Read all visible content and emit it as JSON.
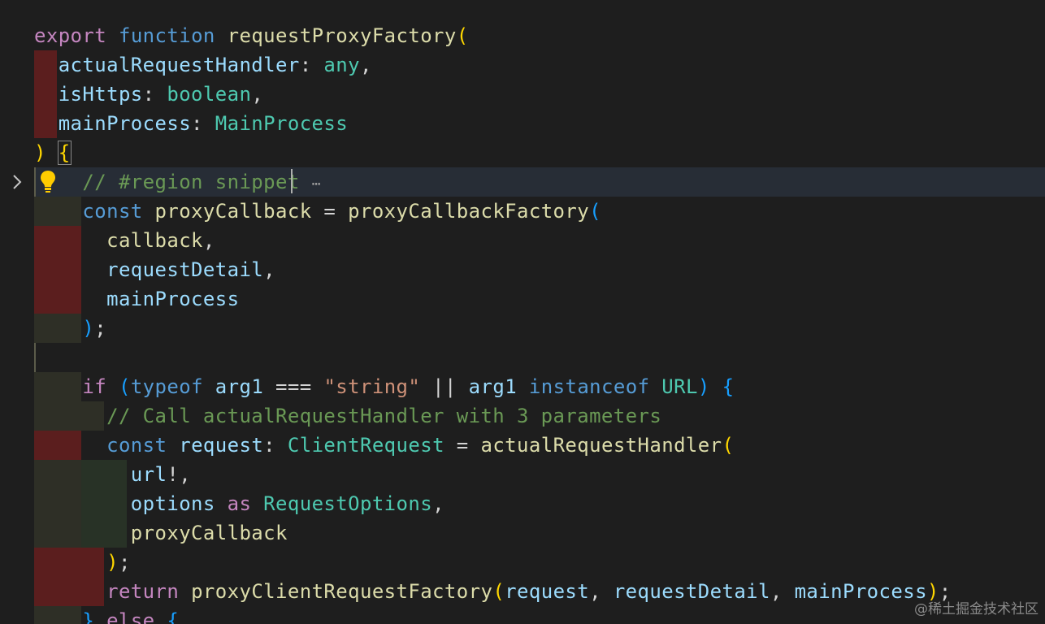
{
  "editor": {
    "language": "typescript",
    "colors": {
      "background": "#1e1e1e",
      "keyword": "#c586c0",
      "storage": "#569cd6",
      "function": "#dcdcaa",
      "variable": "#9cdcfe",
      "type": "#4ec9b0",
      "string": "#ce9178",
      "comment": "#6a9955"
    },
    "icons": {
      "fold": "chevron-right-icon",
      "lightbulb": "lightbulb-icon"
    },
    "lines": {
      "l1": {
        "export": "export",
        "function": "function",
        "name": "requestProxyFactory",
        "paren": "("
      },
      "l2": {
        "param": "actualRequestHandler",
        "colon": ": ",
        "type": "any",
        "comma": ","
      },
      "l3": {
        "param": "isHttps",
        "colon": ": ",
        "type": "boolean",
        "comma": ","
      },
      "l4": {
        "param": "mainProcess",
        "colon": ": ",
        "type": "MainProcess"
      },
      "l5": {
        "close": ")",
        "brace": "{"
      },
      "l6": {
        "comment": "// #region snippet",
        "ellipsis": "⋯"
      },
      "l7": {
        "const": "const",
        "name": "proxyCallback",
        "eq": " = ",
        "fn": "proxyCallbackFactory",
        "paren": "("
      },
      "l8": {
        "arg": "callback",
        "comma": ","
      },
      "l9": {
        "arg": "requestDetail",
        "comma": ","
      },
      "l10": {
        "arg": "mainProcess"
      },
      "l11": {
        "close": ")",
        "semi": ";"
      },
      "l13": {
        "if": "if",
        "open": "(",
        "typeof": "typeof",
        "arg1": "arg1",
        "eqeq": " === ",
        "str": "\"string\"",
        "or": " || ",
        "arg1b": "arg1",
        "instanceof": "instanceof",
        "url": "URL",
        "close": ")",
        "brace": "{"
      },
      "l14": {
        "comment": "// Call actualRequestHandler with 3 parameters"
      },
      "l15": {
        "const": "const",
        "name": "request",
        "colon": ": ",
        "type": "ClientRequest",
        "eq": " = ",
        "fn": "actualRequestHandler",
        "paren": "("
      },
      "l16": {
        "arg": "url",
        "rest": "!,"
      },
      "l17": {
        "arg": "options",
        "as": "as",
        "type": "RequestOptions",
        "comma": ","
      },
      "l18": {
        "arg": "proxyCallback"
      },
      "l19": {
        "close": ")",
        "semi": ";"
      },
      "l20": {
        "return": "return",
        "fn": "proxyClientRequestFactory",
        "open": "(",
        "a1": "request",
        "a2": "requestDetail",
        "a3": "mainProcess",
        "close": ")",
        "semi": ";"
      },
      "l21": {
        "close": "}",
        "else": "else",
        "brace": "{"
      }
    }
  },
  "watermark": "@稀土掘金技术社区"
}
